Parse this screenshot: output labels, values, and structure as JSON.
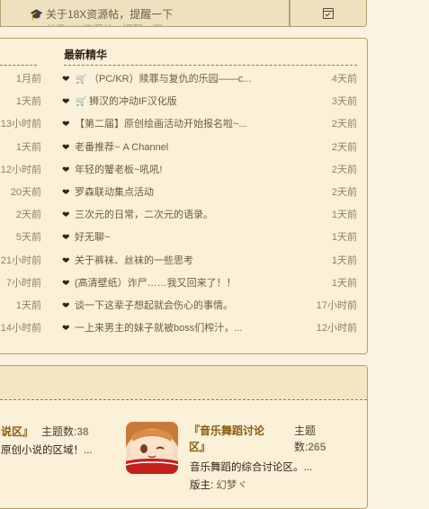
{
  "topbar": {
    "notice": "关于18X资源帖，提醒一下",
    "notice_sub": "关于18X资源帖，提醒一下",
    "icons": [
      "graduation-cap-icon",
      "calendar-check-icon"
    ]
  },
  "panel": {
    "title": "最新精华",
    "left_times": [
      "1月前",
      "1天前",
      "13小时前",
      "1天前",
      "12小时前",
      "20天前",
      "2天前",
      "5天前",
      "21小时前",
      "7小时前",
      "1天前",
      "14小时前"
    ],
    "items": [
      {
        "title": "（PC/KR）赎罪与复仇的乐园——c...",
        "time": "4天前",
        "cart": true
      },
      {
        "title": "狮汉的冲动IF汉化版",
        "time": "3天前",
        "cart": true
      },
      {
        "title": "【第二届】原创绘画活动开始报名啦~...",
        "time": "2天前",
        "cart": false
      },
      {
        "title": "老番推荐~ A Channel",
        "time": "2天前",
        "cart": false
      },
      {
        "title": "年轻的蟹老板~吼吼!",
        "time": "2天前",
        "cart": false
      },
      {
        "title": "罗森联动集点活动",
        "time": "2天前",
        "cart": false
      },
      {
        "title": "三次元的日常，二次元的语录。",
        "time": "1天前",
        "cart": false
      },
      {
        "title": "好无聊~",
        "time": "1天前",
        "cart": false
      },
      {
        "title": "关于裤袜、丝袜的一些思考",
        "time": "1天前",
        "cart": false
      },
      {
        "title": "(高清壁纸）诈尸……我又回来了！！",
        "time": "1天前",
        "cart": false
      },
      {
        "title": "谈一下这辈子想起就会伤心的事情。",
        "time": "17小时前",
        "cart": false
      },
      {
        "title": "一上来男主的妹子就被boss们榨汁，...",
        "time": "12小时前",
        "cart": false
      }
    ]
  },
  "forums": {
    "f1": {
      "name": "说区』",
      "count_label": "主题数:",
      "count": "38",
      "desc": "原创小说的区域！..."
    },
    "f2": {
      "name": "『音乐舞蹈讨论区』",
      "count_label": "主题数:",
      "count": "265",
      "desc": "音乐舞蹈的综合讨论区。...",
      "mod_label": "版主:",
      "mod_name": "幻梦ヾ"
    }
  },
  "colors": {
    "background": "#faf3e1",
    "border": "#b89e6e",
    "forum_title": "#8a5a10",
    "cart": "#e8a000"
  }
}
